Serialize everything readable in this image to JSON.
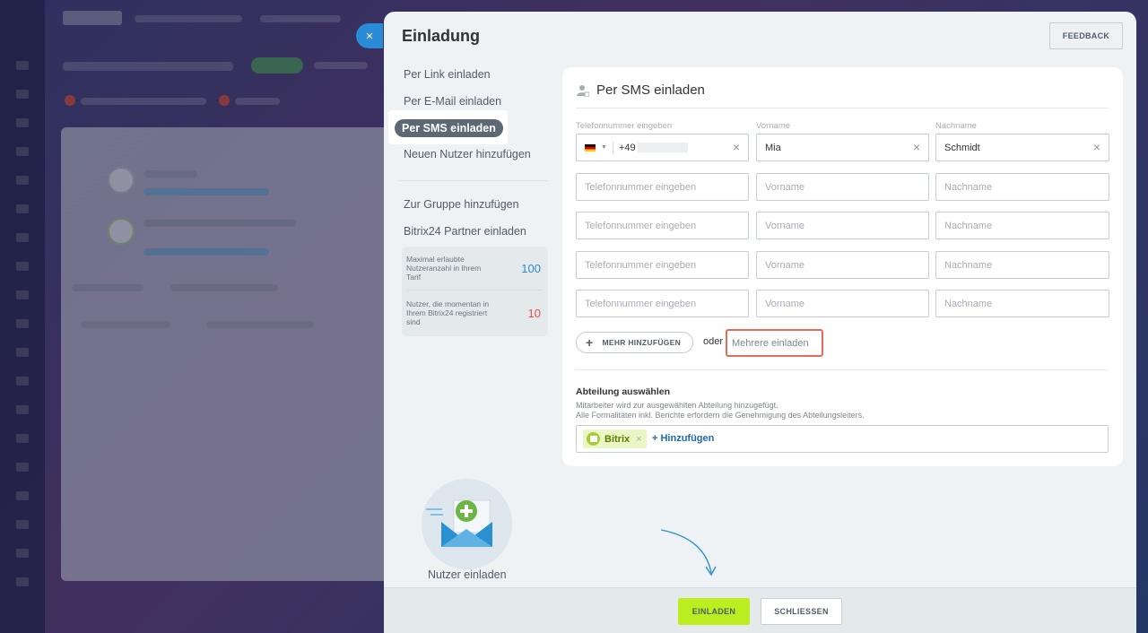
{
  "slider": {
    "title": "Einladung",
    "feedback_label": "FEEDBACK",
    "close_icon": "×"
  },
  "nav": {
    "items": [
      {
        "label": "Per Link einladen"
      },
      {
        "label": "Per E-Mail einladen"
      },
      {
        "label": "Per SMS einladen",
        "active": true
      },
      {
        "label": "Neuen Nutzer hinzufügen"
      },
      {
        "label": "Zur Gruppe hinzufügen"
      },
      {
        "label": "Bitrix24 Partner einladen"
      }
    ]
  },
  "stats": {
    "max_users_label": "Maximal erlaubte Nutzeranzahl in Ihrem Tarif",
    "max_users_value": "100",
    "registered_label": "Nutzer, die momentan in Ihrem Bitrix24 registriert sind",
    "registered_value": "10",
    "colors": {
      "max": "#2a8bd6",
      "registered": "#e8504a"
    }
  },
  "illustration": {
    "label": "Nutzer einladen",
    "icon": "envelope-plus-icon"
  },
  "card": {
    "title": "Per SMS einladen",
    "title_icon": "user-icon",
    "columns": {
      "phone": "Telefonnummer eingeben",
      "first_name": "Vorname",
      "last_name": "Nachname"
    },
    "first_row": {
      "country_code": "+49",
      "first_name": "Mia",
      "last_name": "Schmidt"
    },
    "placeholders": {
      "phone": "Telefonnummer eingeben",
      "first_name": "Vorname",
      "last_name": "Nachname"
    },
    "add_more_label": "MEHR HINZUFÜGEN",
    "or_label": "oder",
    "mass_invite_label": "Mehrere einladen",
    "department": {
      "title": "Abteilung auswählen",
      "desc_line1": "Mitarbeiter wird zur ausgewählten Abteilung hinzugefügt.",
      "desc_line2": "Alle Formalitäten inkl. Berichte erfordern die Genehmigung des Abteilungsleiters.",
      "tag": "Bitrix",
      "add_label": "+ Hinzufügen"
    }
  },
  "footer": {
    "invite_label": "EINLADEN",
    "close_label": "SCHLIESSEN"
  },
  "colors": {
    "accent_green": "#bbed21",
    "link_blue": "#2067b0",
    "highlight_red": "#e86b55"
  }
}
